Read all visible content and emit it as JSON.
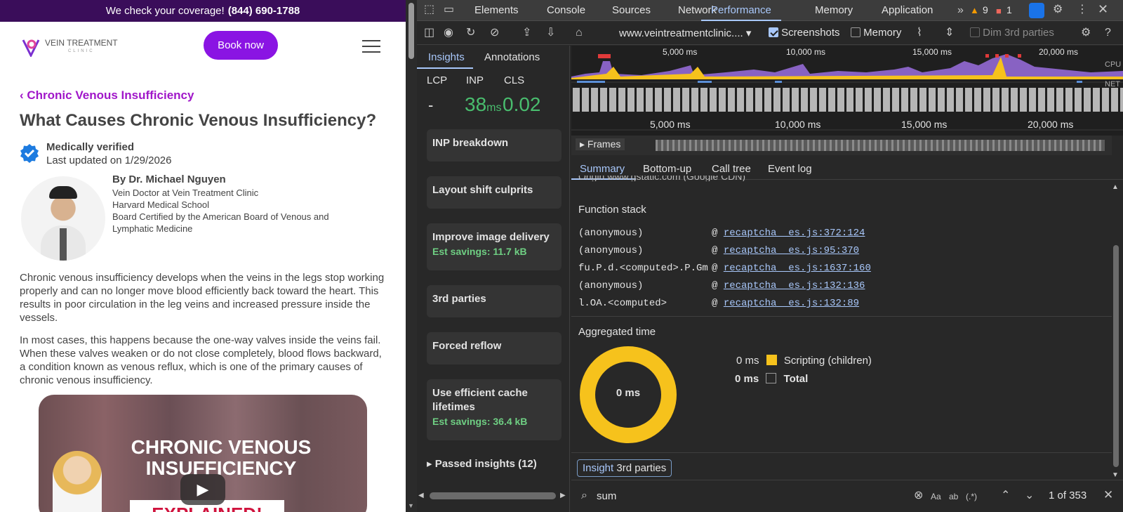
{
  "site": {
    "banner_text": "We check your coverage!",
    "banner_phone": "(844) 690-1788",
    "logo_text": "VEIN TREATMENT",
    "logo_sub": "CLINIC",
    "book_label": "Book now",
    "breadcrumb": "Chronic Venous Insufficiency",
    "title": "What Causes Chronic Venous Insufficiency?",
    "verified_label": "Medically verified",
    "updated": "Last updated on 1/29/2026",
    "author_name": "By Dr. Michael Nguyen",
    "author_lines": [
      "Vein Doctor at Vein Treatment Clinic",
      "Harvard Medical School",
      "Board Certified by the American Board of Venous and Lymphatic Medicine"
    ],
    "para1": "Chronic venous insufficiency develops when the veins in the legs stop working properly and can no longer move blood efficiently back toward the heart. This results in poor circulation in the leg veins and increased pressure inside the vessels.",
    "para2": "In most cases, this happens because the one-way valves inside the veins fail. When these valves weaken or do not close completely, blood flows backward, a condition known as venous reflux, which is one of the primary causes of chronic venous insufficiency.",
    "video_title": "CHRONIC VENOUS INSUFFICIENCY",
    "video_sub": "EXPLAINED!"
  },
  "devtools": {
    "tabs": [
      "Elements",
      "Console",
      "Sources",
      "Network",
      "Performance",
      "Memory",
      "Application"
    ],
    "warnings": "9",
    "errors": "1",
    "url": "www.veintreatmentclinic....",
    "screenshots_label": "Screenshots",
    "memory_label": "Memory",
    "dim_label": "Dim 3rd parties",
    "left_tabs": [
      "Insights",
      "Annotations"
    ],
    "metric_labels": [
      "LCP",
      "INP",
      "CLS"
    ],
    "lcp_value": "-",
    "inp_value": "38",
    "inp_unit": "ms",
    "cls_value": "0.02",
    "insights": [
      {
        "title": "INP breakdown",
        "savings": ""
      },
      {
        "title": "Layout shift culprits",
        "savings": ""
      },
      {
        "title": "Improve image delivery",
        "savings": "Est savings: 11.7 kB"
      },
      {
        "title": "3rd parties",
        "savings": ""
      },
      {
        "title": "Forced reflow",
        "savings": ""
      },
      {
        "title": "Use efficient cache lifetimes",
        "savings": "Est savings: 36.4 kB"
      }
    ],
    "passed": "Passed insights (12)",
    "overview_ticks": [
      "5,000 ms",
      "10,000 ms",
      "15,000 ms",
      "20,000 ms"
    ],
    "cpu_label": "CPU",
    "net_label": "NET",
    "frames_label": "Frames",
    "summary_tabs": [
      "Summary",
      "Bottom-up",
      "Call tree",
      "Event log"
    ],
    "origin_text": "Origin   www.gstatic.com (Google CDN)",
    "function_stack_title": "Function stack",
    "stack": [
      {
        "fn": "(anonymous)",
        "src": "recaptcha__es.js:372:124"
      },
      {
        "fn": "(anonymous)",
        "src": "recaptcha__es.js:95:370"
      },
      {
        "fn": "fu.P.d.<computed>.P.Gm",
        "src": "recaptcha__es.js:1637:160"
      },
      {
        "fn": "(anonymous)",
        "src": "recaptcha__es.js:132:136"
      },
      {
        "fn": "l.OA.<computed>",
        "src": "recaptcha__es.js:132:89"
      }
    ],
    "aggregated_title": "Aggregated time",
    "donut_center": "0 ms",
    "legend": [
      {
        "value": "0 ms",
        "label": "Scripting (children)",
        "color": "#f6c21c"
      },
      {
        "value": "0 ms",
        "label": "Total",
        "color": ""
      }
    ],
    "insight_pill_key": "Insight",
    "insight_pill_value": "3rd parties",
    "search_value": "sum",
    "search_count": "1 of 353"
  }
}
